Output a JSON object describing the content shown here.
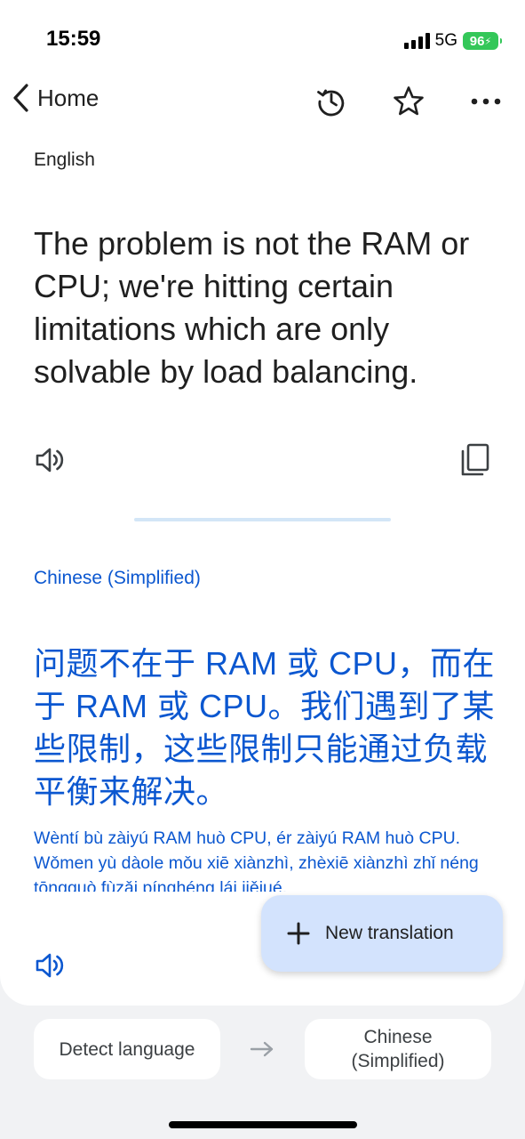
{
  "status_bar": {
    "time": "15:59",
    "network": "5G",
    "battery": "96"
  },
  "nav": {
    "back_label": "Home",
    "icons": [
      "history-icon",
      "star-icon",
      "more-icon"
    ]
  },
  "source": {
    "language": "English",
    "text": "The problem is not the RAM or CPU; we're hitting certain limitations which are only solvable by load balancing."
  },
  "target": {
    "language": "Chinese (Simplified)",
    "text": "问题不在于 RAM 或 CPU，而在于 RAM 或 CPU。我们遇到了某些限制，这些限制只能通过负载平衡来解决。",
    "romanization": "Wèntí bù zàiyú RAM huò CPU, ér zàiyú RAM huò CPU. Wǒmen yù dàole mǒu xiē xiànzhì, zhèxiē xiànzhì zhǐ néng tōngguò fùzǎi pínghéng lái jiějué."
  },
  "fab": {
    "label": "New translation"
  },
  "language_bar": {
    "source_button": "Detect language",
    "target_button_line1": "Chinese",
    "target_button_line2": "(Simplified)"
  },
  "colors": {
    "accent": "#0b57d0",
    "fab_bg": "#d3e3fd",
    "battery": "#34c759"
  }
}
